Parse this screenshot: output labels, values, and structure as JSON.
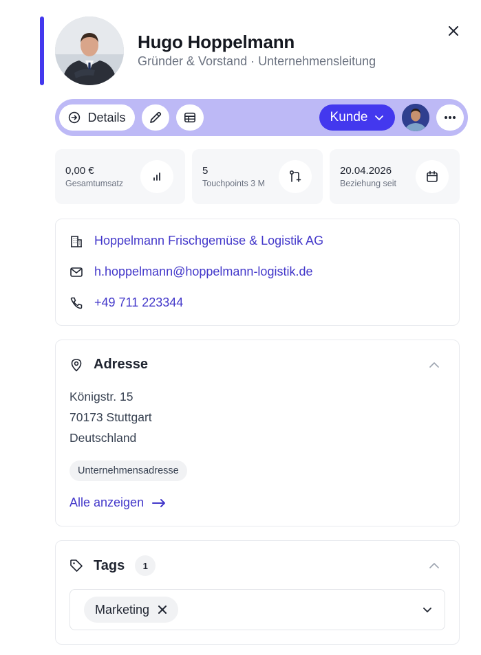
{
  "header": {
    "name": "Hugo Hoppelmann",
    "subtitle": "Gründer & Vorstand · Unternehmensleitung",
    "close_icon": "close-icon"
  },
  "toolbar": {
    "details_label": "Details",
    "status_label": "Kunde",
    "accent_color": "#4338ee",
    "bar_color": "#bdb9f6"
  },
  "stats": [
    {
      "value": "0,00 €",
      "label": "Gesamtumsatz",
      "icon": "bar-chart-icon"
    },
    {
      "value": "5",
      "label": "Touchpoints 3 M",
      "icon": "git-pull-request-icon"
    },
    {
      "value": "20.04.2026",
      "label": "Beziehung seit",
      "icon": "calendar-icon"
    }
  ],
  "contact": {
    "company": "Hoppelmann Frischgemüse & Logistik AG",
    "email": "h.hoppelmann@hoppelmann-logistik.de",
    "phone": "+49 711 223344"
  },
  "address": {
    "title": "Adresse",
    "street": "Königstr. 15",
    "city": "70173 Stuttgart",
    "country": "Deutschland",
    "type": "Unternehmensadresse",
    "show_all": "Alle anzeigen"
  },
  "tags": {
    "title": "Tags",
    "count": "1",
    "items": [
      "Marketing"
    ]
  }
}
